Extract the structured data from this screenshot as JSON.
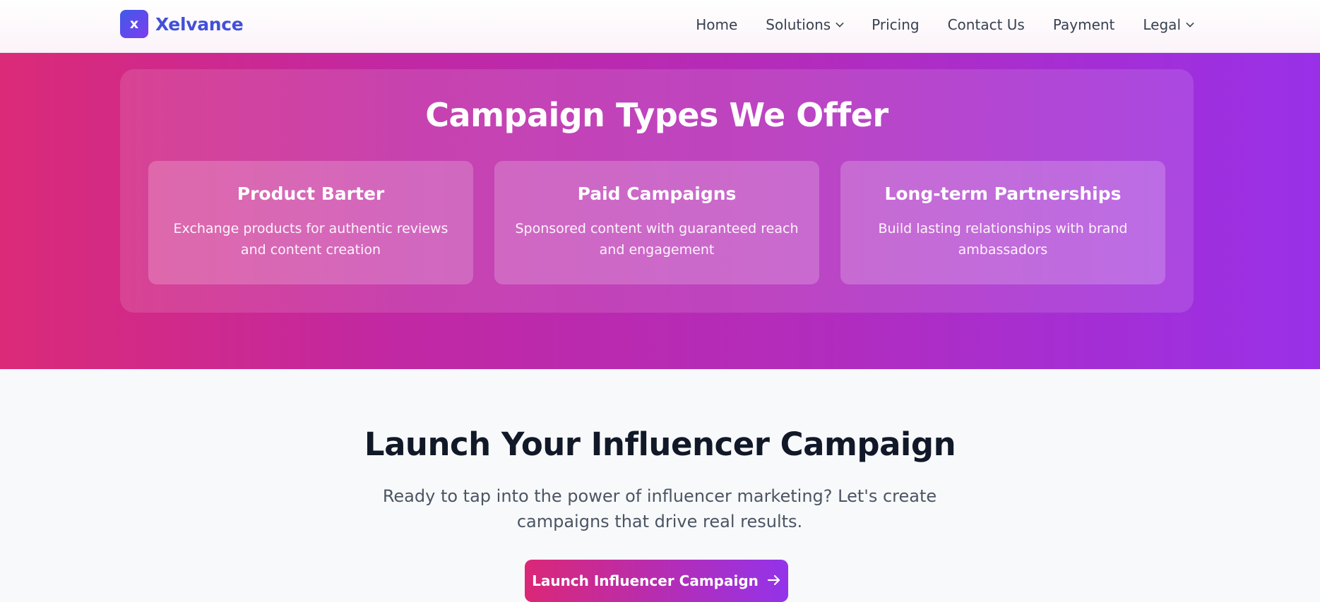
{
  "header": {
    "logo_letter": "x",
    "brand": "Xelvance",
    "nav": [
      {
        "label": "Home",
        "dropdown": false
      },
      {
        "label": "Solutions",
        "dropdown": true
      },
      {
        "label": "Pricing",
        "dropdown": false
      },
      {
        "label": "Contact Us",
        "dropdown": false
      },
      {
        "label": "Payment",
        "dropdown": false
      },
      {
        "label": "Legal",
        "dropdown": true
      }
    ]
  },
  "campaigns": {
    "title": "Campaign Types We Offer",
    "cards": [
      {
        "title": "Product Barter",
        "description": "Exchange products for authentic reviews and content creation"
      },
      {
        "title": "Paid Campaigns",
        "description": "Sponsored content with guaranteed reach and engagement"
      },
      {
        "title": "Long-term Partnerships",
        "description": "Build lasting relationships with brand ambassadors"
      }
    ]
  },
  "cta": {
    "title": "Launch Your Influencer Campaign",
    "text": "Ready to tap into the power of influencer marketing? Let's create campaigns that drive real results.",
    "button_label": "Launch Influencer Campaign",
    "button_icon": "arrow-right-icon"
  },
  "colors": {
    "brand": "#4250d8",
    "gradient_start": "#db2777",
    "gradient_end": "#9333ea"
  }
}
